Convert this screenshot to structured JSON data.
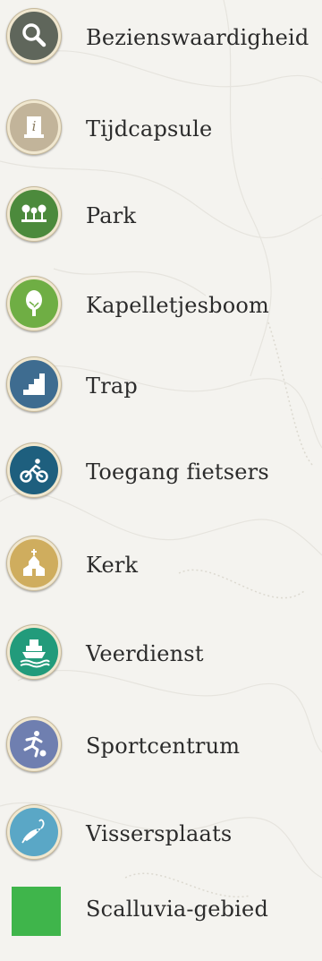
{
  "legend": {
    "items": [
      {
        "label": "Bezienswaardigheid",
        "icon": "magnifier-icon",
        "color": "#5f665b"
      },
      {
        "label": "Tijdcapsule",
        "icon": "info-monument-icon",
        "color": "#c2b49a"
      },
      {
        "label": "Park",
        "icon": "park-trees-icon",
        "color": "#4c8a3c"
      },
      {
        "label": "Kapelletjesboom",
        "icon": "tree-icon",
        "color": "#6fae44"
      },
      {
        "label": "Trap",
        "icon": "stairs-icon",
        "color": "#3e6c90"
      },
      {
        "label": "Toegang fietsers",
        "icon": "cyclist-icon",
        "color": "#1e5f7e"
      },
      {
        "label": "Kerk",
        "icon": "church-icon",
        "color": "#cfad5e"
      },
      {
        "label": "Veerdienst",
        "icon": "ferry-icon",
        "color": "#229b7b"
      },
      {
        "label": "Sportcentrum",
        "icon": "football-player-icon",
        "color": "#6f7fb0"
      },
      {
        "label": "Vissersplaats",
        "icon": "fish-hook-icon",
        "color": "#5aa7c6"
      },
      {
        "label": "Scalluvia-gebied",
        "icon": "green-area-swatch",
        "color": "#3fb54b"
      }
    ]
  }
}
